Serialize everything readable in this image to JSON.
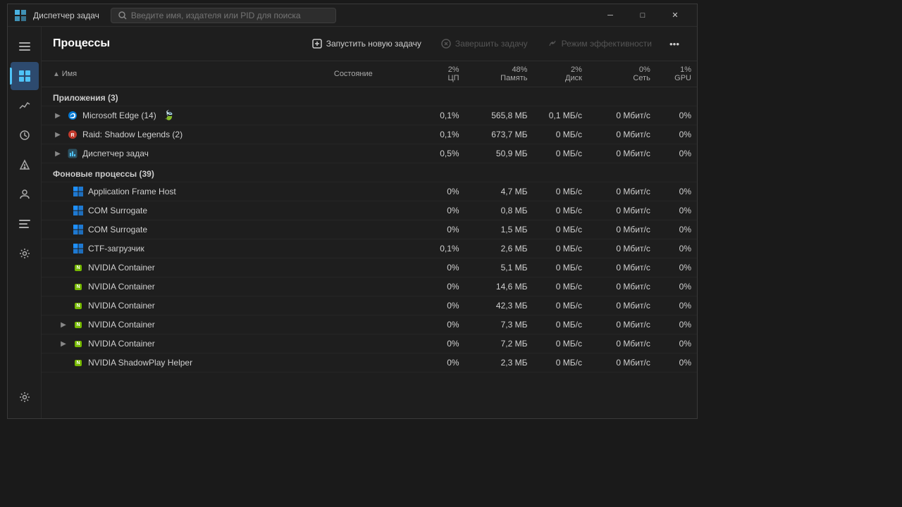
{
  "window": {
    "title": "Диспетчер задач",
    "logo": "⚙"
  },
  "search": {
    "placeholder": "Введите имя, издателя или PID для поиска"
  },
  "titlebar_controls": {
    "minimize": "─",
    "maximize": "□",
    "close": "✕"
  },
  "toolbar": {
    "title": "Процессы",
    "new_task_label": "Запустить новую задачу",
    "end_task_label": "Завершить задачу",
    "efficiency_label": "Режим эффективности",
    "more_label": "..."
  },
  "table": {
    "columns": [
      "Имя",
      "Состояние",
      "2%\nЦП",
      "48%\nПамять",
      "2%\nДиск",
      "0%\nСеть",
      "1%\nGPU"
    ],
    "col_cpu": "2%",
    "col_cpu_sub": "ЦП",
    "col_mem": "48%",
    "col_mem_sub": "Память",
    "col_disk": "2%",
    "col_disk_sub": "Диск",
    "col_net": "0%",
    "col_net_sub": "Сеть",
    "col_gpu": "1%",
    "col_gpu_sub": "GPU"
  },
  "sections": {
    "apps": "Приложения (3)",
    "background": "Фоновые процессы (39)"
  },
  "apps": [
    {
      "name": "Microsoft Edge (14)",
      "icon": "edge",
      "state": "",
      "efficiency": true,
      "cpu": "0,1%",
      "mem": "565,8 МБ",
      "disk": "0,1 МБ/с",
      "net": "0 Мбит/с",
      "gpu": "0%",
      "expandable": true
    },
    {
      "name": "Raid: Shadow Legends (2)",
      "icon": "raid",
      "state": "",
      "efficiency": false,
      "cpu": "0,1%",
      "mem": "673,7 МБ",
      "disk": "0 МБ/с",
      "net": "0 Мбит/с",
      "gpu": "0%",
      "expandable": true
    },
    {
      "name": "Диспетчер задач",
      "icon": "taskmgr",
      "state": "",
      "efficiency": false,
      "cpu": "0,5%",
      "mem": "50,9 МБ",
      "disk": "0 МБ/с",
      "net": "0 Мбит/с",
      "gpu": "0%",
      "expandable": true
    }
  ],
  "background_processes": [
    {
      "name": "Application Frame Host",
      "icon": "win",
      "cpu": "0%",
      "mem": "4,7 МБ",
      "disk": "0 МБ/с",
      "net": "0 Мбит/с",
      "gpu": "0%",
      "expandable": false
    },
    {
      "name": "COM Surrogate",
      "icon": "win",
      "cpu": "0%",
      "mem": "0,8 МБ",
      "disk": "0 МБ/с",
      "net": "0 Мбит/с",
      "gpu": "0%",
      "expandable": false
    },
    {
      "name": "COM Surrogate",
      "icon": "win",
      "cpu": "0%",
      "mem": "1,5 МБ",
      "disk": "0 МБ/с",
      "net": "0 Мбит/с",
      "gpu": "0%",
      "expandable": false
    },
    {
      "name": "CTF-загрузчик",
      "icon": "win",
      "cpu": "0,1%",
      "mem": "2,6 МБ",
      "disk": "0 МБ/с",
      "net": "0 Мбит/с",
      "gpu": "0%",
      "expandable": false
    },
    {
      "name": "NVIDIA Container",
      "icon": "nvidia",
      "cpu": "0%",
      "mem": "5,1 МБ",
      "disk": "0 МБ/с",
      "net": "0 Мбит/с",
      "gpu": "0%",
      "expandable": false
    },
    {
      "name": "NVIDIA Container",
      "icon": "nvidia",
      "cpu": "0%",
      "mem": "14,6 МБ",
      "disk": "0 МБ/с",
      "net": "0 Мбит/с",
      "gpu": "0%",
      "expandable": false
    },
    {
      "name": "NVIDIA Container",
      "icon": "nvidia",
      "cpu": "0%",
      "mem": "42,3 МБ",
      "disk": "0 МБ/с",
      "net": "0 Мбит/с",
      "gpu": "0%",
      "expandable": false
    },
    {
      "name": "NVIDIA Container",
      "icon": "nvidia",
      "cpu": "0%",
      "mem": "7,3 МБ",
      "disk": "0 МБ/с",
      "net": "0 Мбит/с",
      "gpu": "0%",
      "expandable": true
    },
    {
      "name": "NVIDIA Container",
      "icon": "nvidia",
      "cpu": "0%",
      "mem": "7,2 МБ",
      "disk": "0 МБ/с",
      "net": "0 Мбит/с",
      "gpu": "0%",
      "expandable": true
    },
    {
      "name": "NVIDIA ShadowPlay Helper",
      "icon": "nvidia",
      "cpu": "0%",
      "mem": "2,3 МБ",
      "disk": "0 МБ/с",
      "net": "0 Мбит/с",
      "gpu": "0%",
      "expandable": false
    }
  ],
  "sidebar": {
    "items": [
      {
        "id": "hamburger",
        "icon": "☰",
        "active": false
      },
      {
        "id": "processes",
        "icon": "▦",
        "active": true
      },
      {
        "id": "performance",
        "icon": "📈",
        "active": false
      },
      {
        "id": "history",
        "icon": "🕐",
        "active": false
      },
      {
        "id": "startup",
        "icon": "⚡",
        "active": false
      },
      {
        "id": "users",
        "icon": "👥",
        "active": false
      },
      {
        "id": "details",
        "icon": "☰",
        "active": false
      },
      {
        "id": "services",
        "icon": "⚙",
        "active": false
      }
    ],
    "bottom": {
      "id": "settings",
      "icon": "⚙"
    }
  },
  "colors": {
    "accent": "#4fc3f7",
    "bg_dark": "#1e1e1e",
    "bg_sidebar": "#1a1a1a",
    "border": "#2d2d2d",
    "text_primary": "#e0e0e0",
    "text_muted": "#888888",
    "efficiency_green": "#4caf50",
    "nvidia_green": "#76b900",
    "win_blue": "#1e90ff"
  }
}
